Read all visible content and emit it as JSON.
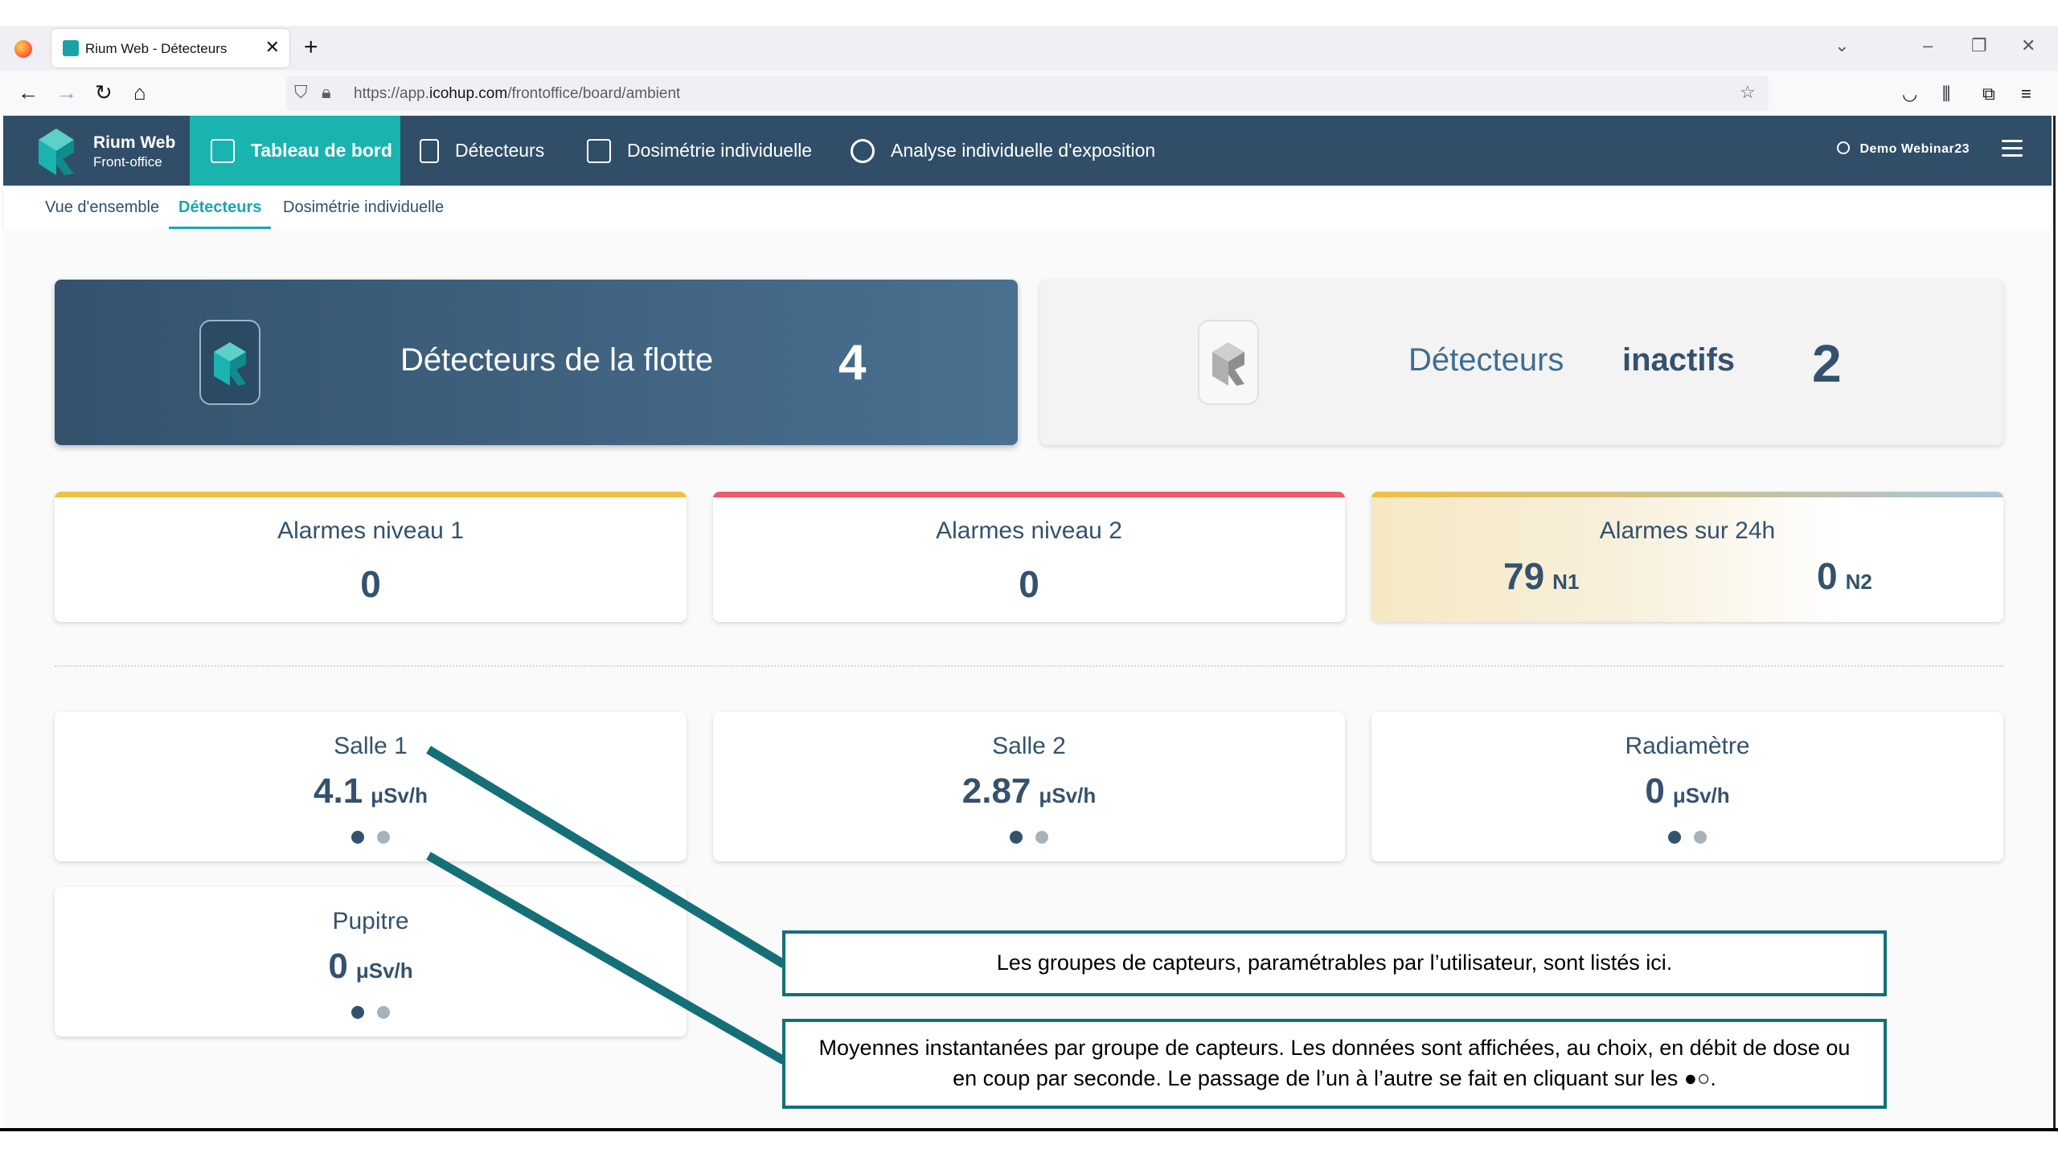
{
  "browser": {
    "tab_title": "Rium Web - Détecteurs",
    "new_tab": "+",
    "tab_close": "✕",
    "url_prefix": "https://app.",
    "url_domain": "icohup.com",
    "url_path": "/frontoffice/board/ambient"
  },
  "brand": {
    "name": "Rium Web",
    "subtitle": "Front-office",
    "accent": "#19b3b0",
    "header_color": "#304e68"
  },
  "menu": [
    {
      "label": "Tableau de bord",
      "icon": "dashboard-icon",
      "active": true
    },
    {
      "label": "Détecteurs",
      "icon": "detector-icon",
      "active": false
    },
    {
      "label": "Dosimétrie individuelle",
      "icon": "id-card-icon",
      "active": false
    },
    {
      "label": "Analyse individuelle d'exposition",
      "icon": "person-search-icon",
      "active": false
    }
  ],
  "user": {
    "name": "Demo Webinar23"
  },
  "subnav": [
    {
      "label": "Vue d'ensemble",
      "active": false
    },
    {
      "label": "Détecteurs",
      "active": true
    },
    {
      "label": "Dosimétrie individuelle",
      "active": false
    }
  ],
  "fleet": {
    "label": "Détecteurs de la flotte",
    "value": "4"
  },
  "inactive": {
    "label": "Détecteurs",
    "label_strong": "inactifs",
    "value": "2"
  },
  "alarms": {
    "level1": {
      "title": "Alarmes niveau 1",
      "value": "0",
      "color": "#f0c040"
    },
    "level2": {
      "title": "Alarmes niveau 2",
      "value": "0",
      "color": "#ef5b6a"
    },
    "last24h": {
      "title": "Alarmes sur 24h",
      "n1_value": "79",
      "n1_unit": "N1",
      "n2_value": "0",
      "n2_unit": "N2"
    }
  },
  "groups": [
    {
      "name": "Salle 1",
      "value": "4.1",
      "unit": "μSv/h"
    },
    {
      "name": "Salle 2",
      "value": "2.87",
      "unit": "μSv/h"
    },
    {
      "name": "Radiamètre",
      "value": "0",
      "unit": "μSv/h"
    },
    {
      "name": "Pupitre",
      "value": "0",
      "unit": "μSv/h"
    }
  ],
  "annotations": {
    "groups_note": "Les groupes de capteurs, paramétrables par l’utilisateur, sont listés ici.",
    "averages_note": "Moyennes instantanées par groupe de capteurs. Les données sont affichées, au choix, en débit de dose ou en coup par seconde. Le passage de l’un à l’autre se fait en cliquant sur les ●○.",
    "color": "#146f77"
  }
}
